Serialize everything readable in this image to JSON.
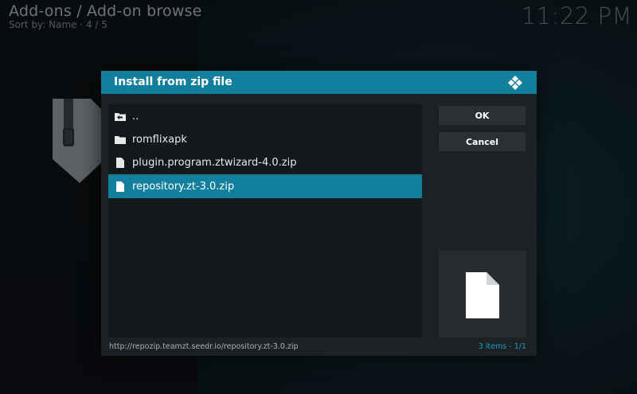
{
  "header": {
    "title": "Add-ons / Add-on browse",
    "subtitle": "Sort by: Name  ·  4 / 5",
    "clock": "11:22 PM"
  },
  "dialog": {
    "title": "Install from zip file",
    "items": [
      {
        "label": "..",
        "icon": "folder-up-icon",
        "selected": false
      },
      {
        "label": "romflixapk",
        "icon": "folder-icon",
        "selected": false
      },
      {
        "label": "plugin.program.ztwizard-4.0.zip",
        "icon": "file-icon",
        "selected": false
      },
      {
        "label": "repository.zt-3.0.zip",
        "icon": "file-icon",
        "selected": true
      }
    ],
    "ok_label": "OK",
    "cancel_label": "Cancel",
    "path": "http://repozip.teamzt.seedr.io/repository.zt-3.0.zip",
    "count": "3 items - 1/1",
    "accent_color": "#12809d"
  }
}
